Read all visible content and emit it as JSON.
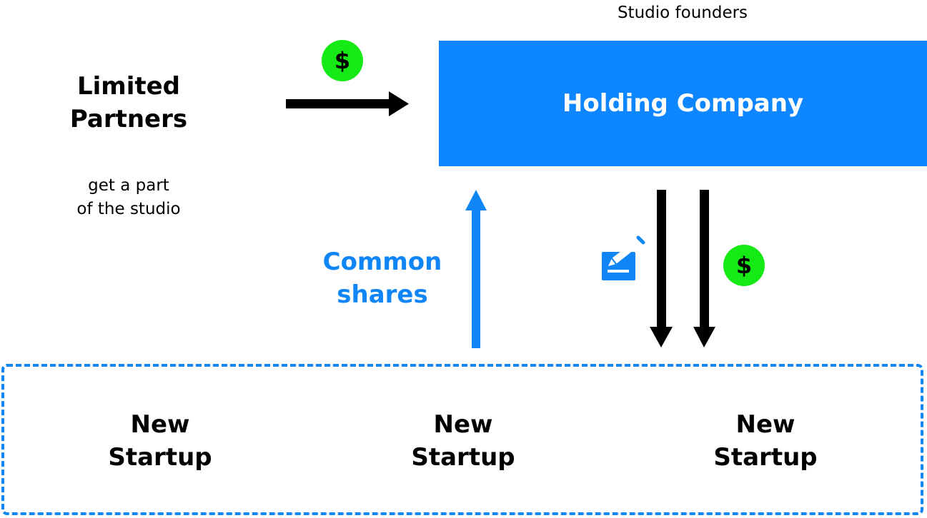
{
  "diagram": {
    "limited_partners": {
      "title_line1": "Limited",
      "title_line2": "Partners",
      "subtitle_line1": "get a part",
      "subtitle_line2": "of the studio"
    },
    "studio_founders_label": "Studio founders",
    "holding_company_label": "Holding Company",
    "common_shares": {
      "line1": "Common",
      "line2": "shares"
    },
    "dollar_symbol": "$",
    "startups": [
      {
        "line1": "New",
        "line2": "Startup"
      },
      {
        "line1": "New",
        "line2": "Startup"
      },
      {
        "line1": "New",
        "line2": "Startup"
      }
    ],
    "icons": [
      "dollar-icon",
      "sign-document-icon",
      "dollar-icon"
    ],
    "colors": {
      "holding_fill": "#0d86ff",
      "accent_blue": "#1085f5",
      "dollar_green": "#16ea16",
      "arrow_black": "#000000"
    }
  }
}
